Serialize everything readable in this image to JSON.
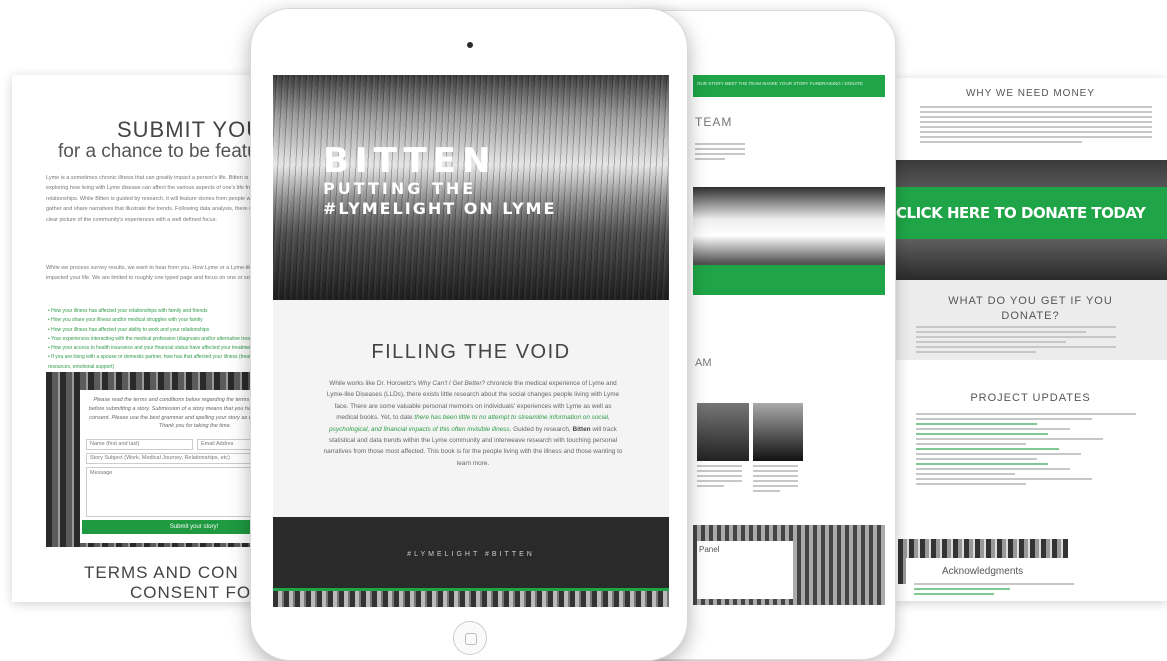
{
  "left_page": {
    "title_line1": "SUBMIT YOUR",
    "title_line2": "for a chance to be featu",
    "para1": "Lyme is a sometimes chronic illness that can greatly impact a person's life. Bitten is a social inquiry exploring how living with Lyme disease can affect the various aspects of one's life from the social relationships. While Bitten is guided by research, it will feature stories from people with Lyme in hope to gather and share narratives that illustrate the trends. Following data analysis, there will be a stronger, more clear picture of the community's experiences with a well defined focus.",
    "para2": "While we process survey results, we want to hear from you. How Lyme or a Lyme-like Disease has impacted your life. We are limited to roughly one typed page and focus on one or some of:",
    "list": [
      "How your illness has affected your relationships with family and friends",
      "How you share your illness and/or medical struggles with your family",
      "How your illness has affected your ability to work and your relationships",
      "Your experiences interacting with the medical profession (diagnosis and/or alternative treatment)",
      "How your access to health insurance and your financial status have affected your treatment",
      "If you are living with a spouse or domestic partner, how has that affected your illness (treatment, financial resources, emotional support)"
    ],
    "form_note": "Please read the terms and conditions below regarding the terms of your submission before submitting a story. Submission of a story means that you have read and that you consent. Please use the best grammar and spelling your story as earnestly as you can. Thank you for taking the time.",
    "name_placeholder": "Name (first and last)",
    "email_placeholder": "Email Addres",
    "subject_placeholder": "Story Subject (Work, Medical Journey, Relationships, etc)",
    "message_placeholder": "Message",
    "submit_label": "Submit your story!",
    "terms_line1": "TERMS AND CON",
    "terms_line2": "CONSENT FO"
  },
  "right_page": {
    "heading_money": "WHY WE NEED MONEY",
    "donate_label": "CLICK HERE TO DONATE TODAY",
    "what_line1": "WHAT DO YOU GET IF YOU",
    "what_line2": "DONATE?",
    "updates_heading": "PROJECT UPDATES",
    "ack_heading": "Acknowledgments"
  },
  "back_ipad": {
    "nav_text": "OUR STORY   MEET THE TEAM   SHARE YOUR STORY   FUNDRAISING / DONATE",
    "team_heading": "TEAM",
    "am_heading": "AM",
    "panel_label": "Panel"
  },
  "front_ipad": {
    "hero_title": "BITTEN",
    "hero_line2": "PUTTING THE",
    "hero_line3": "#LYMELIGHT ON LYME",
    "section_title": "FILLING THE VOID",
    "body_a": "While works like Dr. Horowitz's ",
    "body_italic_title": "Why Can't I Get Better?",
    "body_b": " chronicle the medical experience of Lyme and Lyme-like Diseases (LLDs), there exists little research about the social changes people living with Lyme face. There are some valuable personal memoirs on individuals' experiences with Lyme as well as medical books. Yet, to date ",
    "body_green": "there has been little to no attempt to streamline information on social, psychological, and financial impacts of this often invisible illness.",
    "body_c": " Guided by research, ",
    "body_bold": "Bitten",
    "body_d": " will track statistical and data trends within the Lyme community and interweave research with touching personal narratives from those most affected. This book is for the people living with the illness and those wanting to learn more.",
    "footer_tags": "#LYMELIGHT   #BITTEN"
  },
  "colors": {
    "accent_green": "#1fa547",
    "dark_footer": "#2a2a2a"
  }
}
